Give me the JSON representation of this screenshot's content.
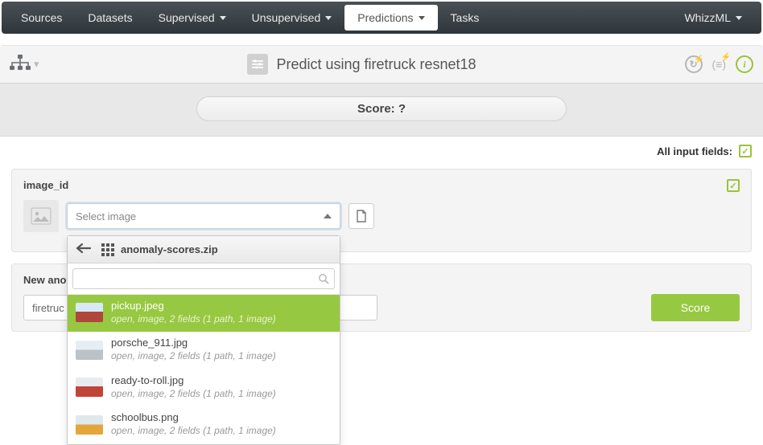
{
  "nav": {
    "items": [
      {
        "label": "Sources"
      },
      {
        "label": "Datasets"
      },
      {
        "label": "Supervised",
        "caret": true
      },
      {
        "label": "Unsupervised",
        "caret": true
      },
      {
        "label": "Predictions",
        "caret": true,
        "active": true
      },
      {
        "label": "Tasks"
      }
    ],
    "right": {
      "label": "WhizzML",
      "caret": true
    }
  },
  "titlebar": {
    "title": "Predict using firetruck resnet18"
  },
  "score_bar": {
    "text": "Score: ?"
  },
  "all_input_fields": {
    "label": "All input fields:"
  },
  "field": {
    "label": "image_id",
    "placeholder": "Select image"
  },
  "dropdown": {
    "source_name": "anomaly-scores.zip",
    "search_value": "",
    "items": [
      {
        "name": "pickup.jpeg",
        "meta": "open, image, 2 fields (1 path, 1 image)",
        "selected": true,
        "thumb": "tp-red"
      },
      {
        "name": "porsche_911.jpg",
        "meta": "open, image, 2 fields (1 path, 1 image)",
        "thumb": "tp-silver"
      },
      {
        "name": "ready-to-roll.jpg",
        "meta": "open, image, 2 fields (1 path, 1 image)",
        "thumb": "tp-fire"
      },
      {
        "name": "schoolbus.png",
        "meta": "open, image, 2 fields (1 path, 1 image)",
        "thumb": "tp-bus"
      }
    ]
  },
  "prediction": {
    "label": "New ano",
    "value": "firetruc"
  },
  "score_button": "Score"
}
